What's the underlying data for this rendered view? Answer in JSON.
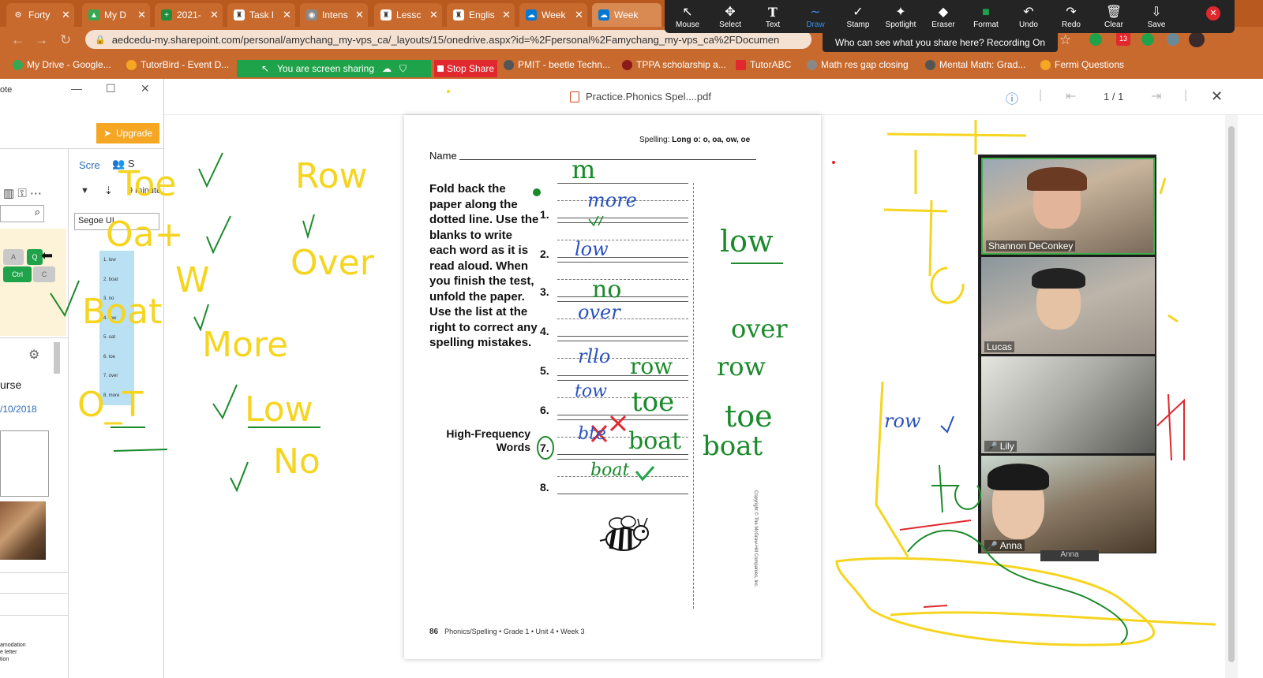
{
  "browser": {
    "tabs": [
      {
        "label": "Forty",
        "fav_color": "#8a8a8a",
        "fav_glyph": "⚙"
      },
      {
        "label": "My D",
        "fav_color": "#34a853",
        "fav_glyph": "▲"
      },
      {
        "label": "2021-",
        "fav_color": "#1e8e3e",
        "fav_glyph": "+"
      },
      {
        "label": "Task l",
        "fav_color": "#ffffff",
        "fav_glyph": "♜"
      },
      {
        "label": "Intens",
        "fav_color": "#888888",
        "fav_glyph": "◉"
      },
      {
        "label": "Lessc",
        "fav_color": "#ffffff",
        "fav_glyph": "♜"
      },
      {
        "label": "Englis",
        "fav_color": "#ffffff",
        "fav_glyph": "♜"
      },
      {
        "label": "Week",
        "fav_color": "#0078d4",
        "fav_glyph": "☁"
      },
      {
        "label": "Week",
        "fav_color": "#0078d4",
        "fav_glyph": "☁"
      }
    ],
    "url": "aedcedu-my.sharepoint.com/personal/amychang_my-vps_ca/_layouts/15/onedrive.aspx?id=%2Fpersonal%2Famychang_my-vps_ca%2FDocumen",
    "notif_count": "13",
    "bookmarks": [
      {
        "label": "My Drive - Google...",
        "color": "#34a853"
      },
      {
        "label": "TutorBird - Event D...",
        "color": "#f5a623"
      },
      {
        "label": "PMIT - beetle Techn...",
        "color": "#555555"
      },
      {
        "label": "TPPA scholarship a...",
        "color": "#8b1a1a"
      },
      {
        "label": "TutorABC",
        "color": "#e0282e"
      },
      {
        "label": "Math res gap closing",
        "color": "#888888"
      },
      {
        "label": "Mental Math: Grad...",
        "color": "#555555"
      },
      {
        "label": "Fermi Questions",
        "color": "#f5a623"
      }
    ]
  },
  "zoom": {
    "sharing_text": "You are screen sharing",
    "stop_share": "Stop Share",
    "tools": [
      {
        "label": "Mouse",
        "icon": "↖"
      },
      {
        "label": "Select",
        "icon": "✥"
      },
      {
        "label": "Text",
        "icon": "T"
      },
      {
        "label": "Draw",
        "icon": "∼"
      },
      {
        "label": "Stamp",
        "icon": "✓"
      },
      {
        "label": "Spotlight",
        "icon": "✦"
      },
      {
        "label": "Eraser",
        "icon": "◆"
      },
      {
        "label": "Format",
        "icon": "■"
      },
      {
        "label": "Undo",
        "icon": "↶"
      },
      {
        "label": "Redo",
        "icon": "↷"
      },
      {
        "label": "Clear",
        "icon": "🗑"
      },
      {
        "label": "Save",
        "icon": "⇩"
      }
    ],
    "active_tool": "Draw",
    "format_color": "#1fa34a",
    "who_can_see": "Who can see what you share here? Recording On",
    "participants": [
      {
        "name": "Shannon DeConkey",
        "muted": false,
        "bg1": "#8fa3b8",
        "bg2": "#c9b8a0"
      },
      {
        "name": "Lucas",
        "muted": false,
        "bg1": "#7e8a90",
        "bg2": "#b8b0a4"
      },
      {
        "name": "Lily",
        "muted": true,
        "bg1": "#9a9a92",
        "bg2": "#dcdcd6"
      },
      {
        "name": "Anna",
        "muted": true,
        "bg1": "#6a5a4a",
        "bg2": "#c8b49a"
      }
    ],
    "anna_label": "Anna"
  },
  "onenote": {
    "title_fragment": "ote",
    "upgrade": "Upgrade",
    "screen_tab": "Scre",
    "share_tab": "S",
    "minutes_text": "9 minute",
    "font_name": "Segoe UI",
    "key_ctrl": "Ctrl",
    "key_q": "Q",
    "key_a": "A",
    "key_c": "C",
    "list_items": [
      "1. low",
      "2. boat",
      "3. no",
      "4. row",
      "5. oat",
      "6. toe",
      "7. over",
      "8. more"
    ],
    "course_text": "urse",
    "date_text": "/10/2018",
    "accom_lines": [
      "amodation",
      "e letter",
      "tion"
    ]
  },
  "pdf_viewer": {
    "filename": "Practice.Phonics Spel....pdf",
    "page_indicator": "1 / 1"
  },
  "worksheet": {
    "spelling_label": "Spelling:",
    "spelling_topic": "Long o: o, oa, ow, oe",
    "name_label": "Name",
    "instructions": "Fold back the paper along the dotted line. Use the blanks to write each word as it is read aloud. When you finish the test, unfold the paper. Use the list at the right to correct any spelling mistakes.",
    "high_freq": "High-Frequency Words",
    "numbers": [
      "1.",
      "2.",
      "3.",
      "4.",
      "5.",
      "6.",
      "7.",
      "8."
    ],
    "footer_page": "86",
    "footer_text": "Phonics/Spelling • Grade 1 • Unit 4 • Week 3",
    "copyright": "Copyright © The McGraw-Hill Companies, Inc."
  },
  "annotations": {
    "yellow_left": [
      "Toe",
      "Oa+",
      "W",
      "Boat",
      "More",
      "O_T",
      "Row",
      "Over",
      "Low",
      "No"
    ],
    "yellow_right": "row",
    "blue_words": [
      "more",
      "low",
      "over",
      "rllo",
      "tow",
      "bte",
      "boat"
    ],
    "green_words": [
      "m",
      "no",
      "row",
      "toe",
      "boat"
    ],
    "green_right": [
      "low",
      "over",
      "row",
      "toe",
      "boat"
    ],
    "colors": {
      "yellow": "#f5d520",
      "green": "#1a8a2a",
      "blue": "#2a52be",
      "red": "#e0282e"
    }
  }
}
